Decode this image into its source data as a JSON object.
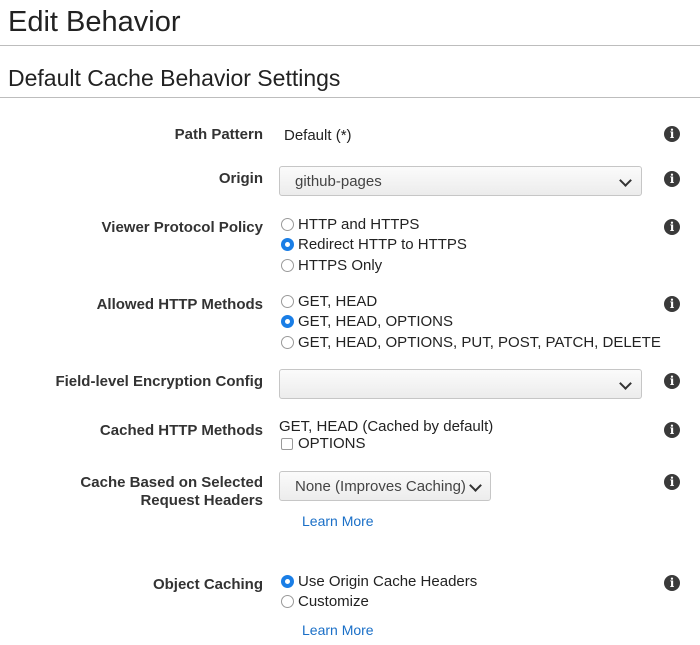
{
  "page": {
    "title": "Edit Behavior",
    "section_title": "Default Cache Behavior Settings"
  },
  "fields": {
    "path_pattern": {
      "label": "Path Pattern",
      "value": "Default (*)"
    },
    "origin": {
      "label": "Origin",
      "value": "github-pages"
    },
    "viewer_protocol_policy": {
      "label": "Viewer Protocol Policy",
      "options": [
        "HTTP and HTTPS",
        "Redirect HTTP to HTTPS",
        "HTTPS Only"
      ],
      "selected": "Redirect HTTP to HTTPS"
    },
    "allowed_http_methods": {
      "label": "Allowed HTTP Methods",
      "options": [
        "GET, HEAD",
        "GET, HEAD, OPTIONS",
        "GET, HEAD, OPTIONS, PUT, POST, PATCH, DELETE"
      ],
      "selected": "GET, HEAD, OPTIONS"
    },
    "field_level_encryption": {
      "label": "Field-level Encryption Config",
      "value": ""
    },
    "cached_http_methods": {
      "label": "Cached HTTP Methods",
      "default_text": "GET, HEAD (Cached by default)",
      "checkbox_label": "OPTIONS",
      "checked": false
    },
    "cache_headers": {
      "label_line1": "Cache Based on Selected",
      "label_line2": "Request Headers",
      "value": "None (Improves Caching)",
      "link": "Learn More"
    },
    "object_caching": {
      "label": "Object Caching",
      "options": [
        "Use Origin Cache Headers",
        "Customize"
      ],
      "selected": "Use Origin Cache Headers",
      "link": "Learn More"
    }
  },
  "icons": {
    "info": "info-icon",
    "info_glyph": "i",
    "chevron": "chevron-down-icon"
  },
  "colors": {
    "accent": "#1a7ee6",
    "link": "#1a6fc7"
  }
}
